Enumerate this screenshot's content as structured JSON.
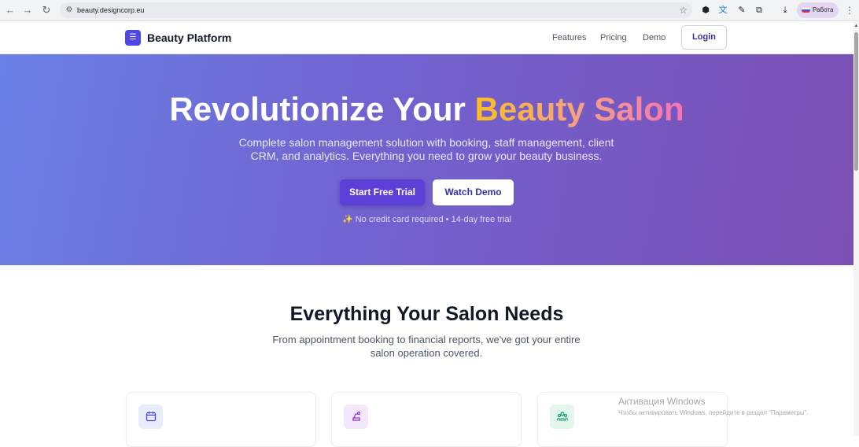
{
  "browser": {
    "url": "beauty.designcorp.eu",
    "profile_label": "Работа",
    "icons": [
      "back-icon",
      "forward-icon",
      "reload-icon",
      "site-settings-icon",
      "bookmark-star-icon",
      "extension-icon",
      "translate-icon",
      "pen-icon",
      "puzzle-icon",
      "download-icon",
      "menu-icon"
    ]
  },
  "header": {
    "brand": "Beauty Platform",
    "nav": [
      "Features",
      "Pricing",
      "Demo"
    ],
    "login": "Login"
  },
  "hero": {
    "title_plain": "Revolutionize Your",
    "title_highlight": "Beauty Salon",
    "subtitle": "Complete salon management solution with booking, staff management, client CRM, and analytics. Everything you need to grow your beauty business.",
    "primary_cta": "Start Free Trial",
    "secondary_cta": "Watch Demo",
    "note": "✨ No credit card required • 14-day free trial"
  },
  "features": {
    "title": "Everything Your Salon Needs",
    "subtitle": "From appointment booking to financial reports, we've got your entire salon operation covered.",
    "cards": [
      {
        "icon": "calendar-icon",
        "color": "#e8ecfb"
      },
      {
        "icon": "salon-chair-icon",
        "color": "#f3e8fb"
      },
      {
        "icon": "team-icon",
        "color": "#e3f7ec"
      }
    ]
  },
  "watermark": {
    "title": "Активация Windows",
    "subtitle": "Чтобы активировать Windows, перейдите в раздел \"Параметры\"."
  },
  "colors": {
    "brand": "#4f46e5",
    "hero_start": "#6a80e6",
    "hero_end": "#7a4fb3",
    "highlight_start": "#fbbf24",
    "highlight_end": "#f472b6"
  }
}
